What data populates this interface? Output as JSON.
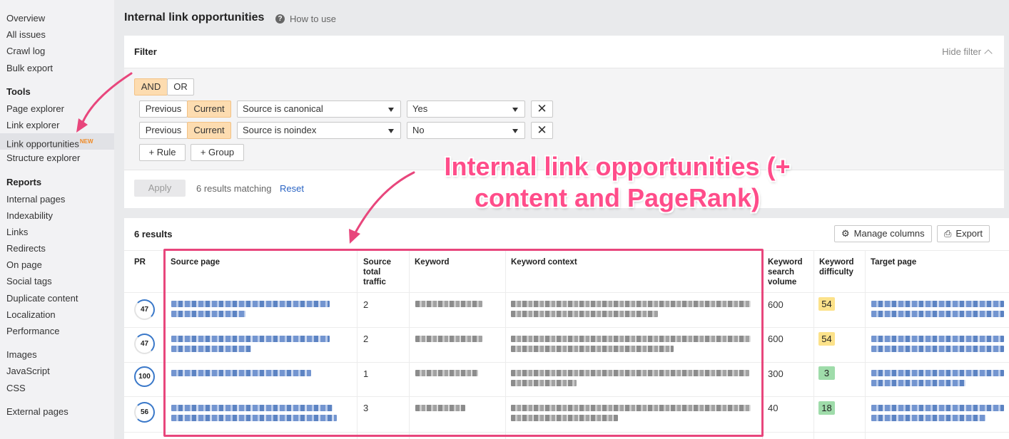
{
  "sidebar": {
    "items_top": [
      "Overview",
      "All issues",
      "Crawl log",
      "Bulk export"
    ],
    "tools_heading": "Tools",
    "tools": [
      "Page explorer",
      "Link explorer",
      "Link opportunities",
      "Structure explorer"
    ],
    "new_badge": "NEW",
    "reports_heading": "Reports",
    "reports": [
      "Internal pages",
      "Indexability",
      "Links",
      "Redirects",
      "On page",
      "Social tags",
      "Duplicate content",
      "Localization",
      "Performance"
    ],
    "tech": [
      "Images",
      "JavaScript",
      "CSS"
    ],
    "external": "External pages"
  },
  "header": {
    "title": "Internal link opportunities",
    "help": "How to use",
    "help_icon": "question-circle-icon"
  },
  "filter": {
    "title": "Filter",
    "hide": "Hide filter",
    "and": "AND",
    "or": "OR",
    "rules": [
      {
        "previous": "Previous",
        "current": "Current",
        "field": "Source is canonical",
        "value": "Yes"
      },
      {
        "previous": "Previous",
        "current": "Current",
        "field": "Source is noindex",
        "value": "No"
      }
    ],
    "add_rule": "Rule",
    "add_group": "Group",
    "apply": "Apply",
    "matching": "6 results matching",
    "reset": "Reset"
  },
  "results": {
    "count": "6 results",
    "manage_columns": "Manage columns",
    "export": "Export",
    "columns": {
      "pr": "PR",
      "source_page": "Source page",
      "source_traffic": [
        "Source",
        "total",
        "traffic"
      ],
      "keyword": "Keyword",
      "keyword_context": "Keyword context",
      "search_volume": [
        "Keyword",
        "search",
        "volume"
      ],
      "difficulty": [
        "Keyword",
        "difficulty"
      ],
      "target_page": "Target page"
    },
    "rows": [
      {
        "pr": "47",
        "traffic": "2",
        "volume": "600",
        "kd": "54"
      },
      {
        "pr": "47",
        "traffic": "2",
        "volume": "600",
        "kd": "54"
      },
      {
        "pr": "100",
        "traffic": "1",
        "volume": "300",
        "kd": "3"
      },
      {
        "pr": "56",
        "traffic": "3",
        "volume": "40",
        "kd": "18"
      }
    ]
  },
  "annotation": {
    "line1": "Internal link opportunities (+",
    "line2": "content and PageRank)"
  },
  "colors": {
    "accent_pink": "#e8467c",
    "link_blue": "#2a64c4",
    "kd_yellow": "#fce28a",
    "kd_green": "#9fdcaa",
    "toggle_orange": "#fddcb0"
  }
}
